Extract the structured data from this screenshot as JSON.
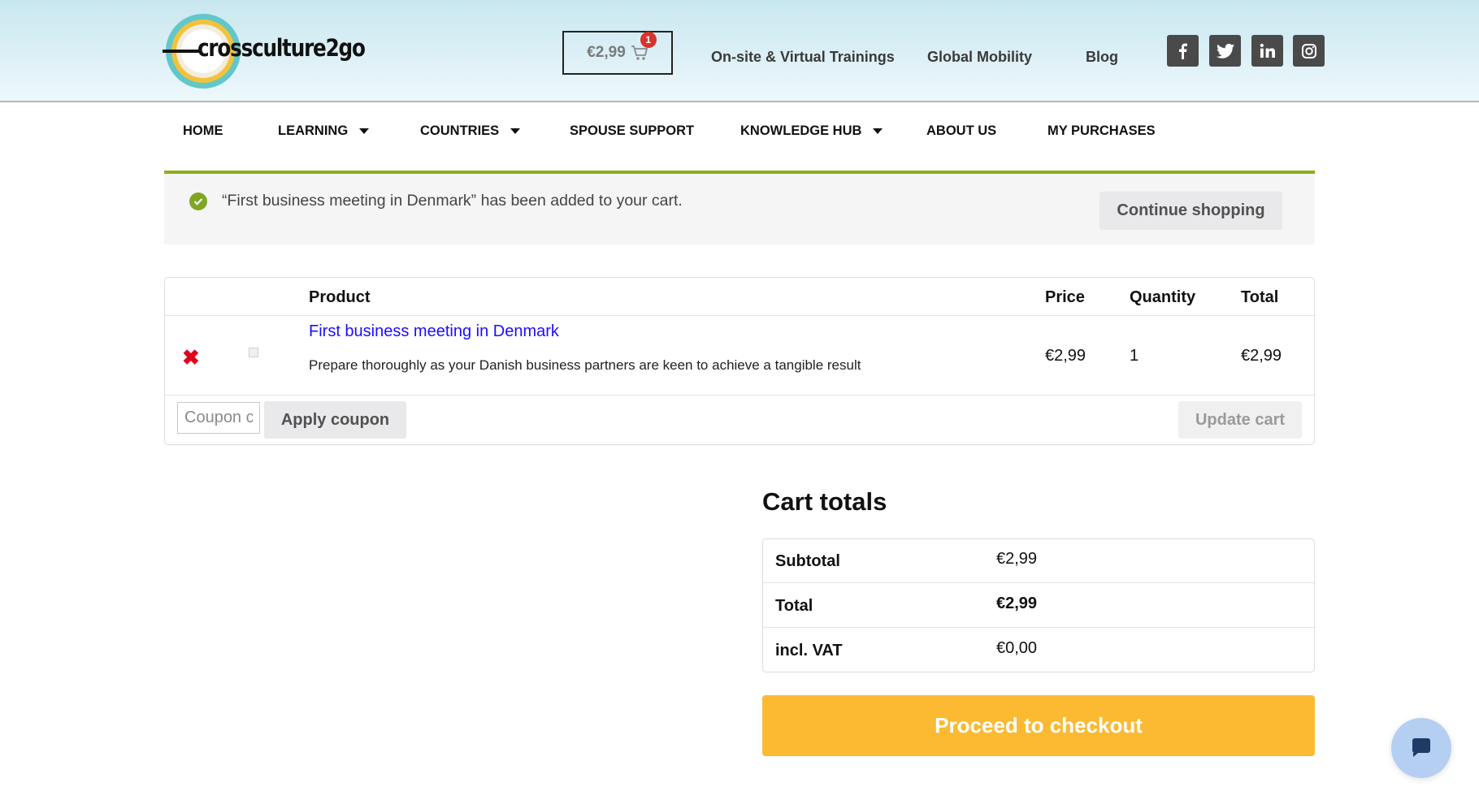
{
  "header": {
    "logo_text": "crossculture2go",
    "cart": {
      "amount": "€2,99",
      "badge_count": "1",
      "icon": "cart-icon"
    },
    "links": [
      "On-site & Virtual Trainings",
      "Global Mobility",
      "Blog"
    ],
    "social": [
      {
        "name": "facebook",
        "glyph": "f"
      },
      {
        "name": "twitter",
        "glyph": "t"
      },
      {
        "name": "linkedin",
        "glyph": "in"
      },
      {
        "name": "instagram",
        "glyph": "ig"
      }
    ]
  },
  "nav": {
    "items": [
      {
        "label": "HOME",
        "dropdown": false
      },
      {
        "label": "LEARNING",
        "dropdown": true
      },
      {
        "label": "COUNTRIES",
        "dropdown": true
      },
      {
        "label": "SPOUSE SUPPORT",
        "dropdown": false
      },
      {
        "label": "KNOWLEDGE HUB",
        "dropdown": true
      },
      {
        "label": "ABOUT US",
        "dropdown": false
      },
      {
        "label": "MY PURCHASES",
        "dropdown": false
      }
    ]
  },
  "notice": {
    "message": "“First business meeting in Denmark” has been added to your cart.",
    "continue_label": "Continue shopping"
  },
  "cart_table": {
    "headers": {
      "product": "Product",
      "price": "Price",
      "quantity": "Quantity",
      "total": "Total"
    },
    "item": {
      "name": "First business meeting in Denmark",
      "description": "Prepare thoroughly as your Danish business partners are keen to achieve a tangible result",
      "price": "€2,99",
      "quantity": "1",
      "total": "€2,99"
    },
    "coupon_placeholder": "Coupon code",
    "apply_coupon_label": "Apply coupon",
    "update_cart_label": "Update cart"
  },
  "totals": {
    "title": "Cart totals",
    "subtotal_label": "Subtotal",
    "subtotal_value": "€2,99",
    "total_label": "Total",
    "total_value": "€2,99",
    "vat_label": "incl. VAT",
    "vat_value": "€0,00",
    "checkout_label": "Proceed to checkout"
  },
  "colors": {
    "accent": "#fbba32",
    "notice_border": "#8fae1b",
    "link": "#1a0dff",
    "remove": "#e2001a",
    "badge": "#d9332b"
  }
}
